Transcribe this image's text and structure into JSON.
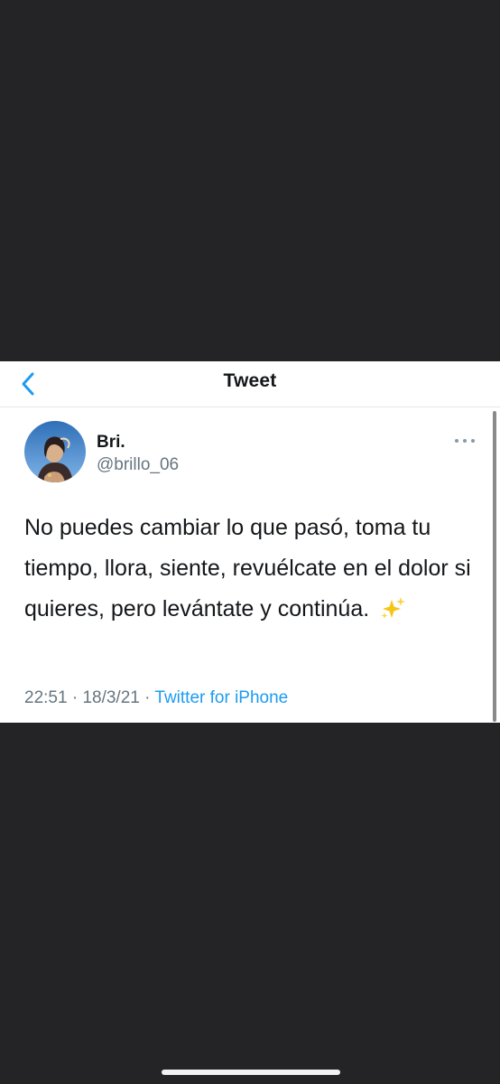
{
  "navbar": {
    "back_icon": "chevron-left-icon",
    "title": "Tweet"
  },
  "tweet": {
    "display_name": "Bri.",
    "handle": "@brillo_06",
    "more_icon": "more-horizontal-icon",
    "text": "No puedes cambiar lo que pasó, toma tu tiempo, llora, siente, revuélcate en el dolor si quieres, pero levántate y continúa.",
    "emoji": "sparkles-icon",
    "time": "22:51",
    "separator": " · ",
    "date": "18/3/21",
    "source": "Twitter for iPhone"
  },
  "colors": {
    "accent": "#1d9bf0",
    "background_dark": "#242426",
    "card": "#ffffff",
    "secondary_text": "#66757f"
  }
}
